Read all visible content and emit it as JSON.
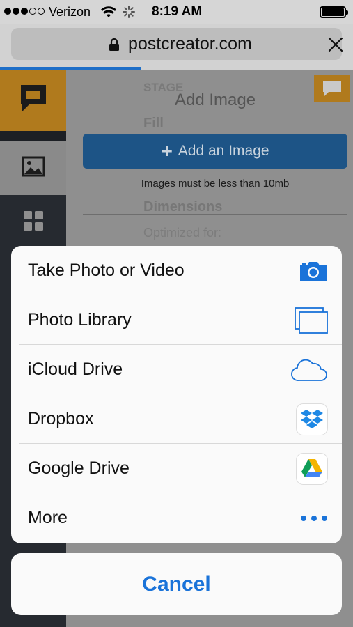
{
  "status_bar": {
    "carrier": "Verizon",
    "time": "8:19 AM",
    "signal_bars_filled": 3,
    "signal_bars_total": 5
  },
  "browser": {
    "url": "postcreator.com",
    "load_progress": 0.4
  },
  "background_page": {
    "stage_label": "STAGE",
    "panel_title": "Add Image",
    "fill_label": "Fill",
    "add_image_button": "Add an Image",
    "size_note": "Images must be less than 10mb",
    "dimensions_label": "Dimensions",
    "optimized_label": "Optimized for:"
  },
  "action_sheet": {
    "items": [
      {
        "label": "Take Photo or Video",
        "icon": "camera-icon"
      },
      {
        "label": "Photo Library",
        "icon": "photo-library-icon"
      },
      {
        "label": "iCloud Drive",
        "icon": "icloud-icon"
      },
      {
        "label": "Dropbox",
        "icon": "dropbox-icon"
      },
      {
        "label": "Google Drive",
        "icon": "google-drive-icon"
      },
      {
        "label": "More",
        "icon": "more-icon"
      }
    ],
    "cancel_label": "Cancel"
  },
  "colors": {
    "accent_blue": "#1a73d9",
    "brand_orange": "#f0a52a",
    "sidebar_dark": "#262a30"
  }
}
